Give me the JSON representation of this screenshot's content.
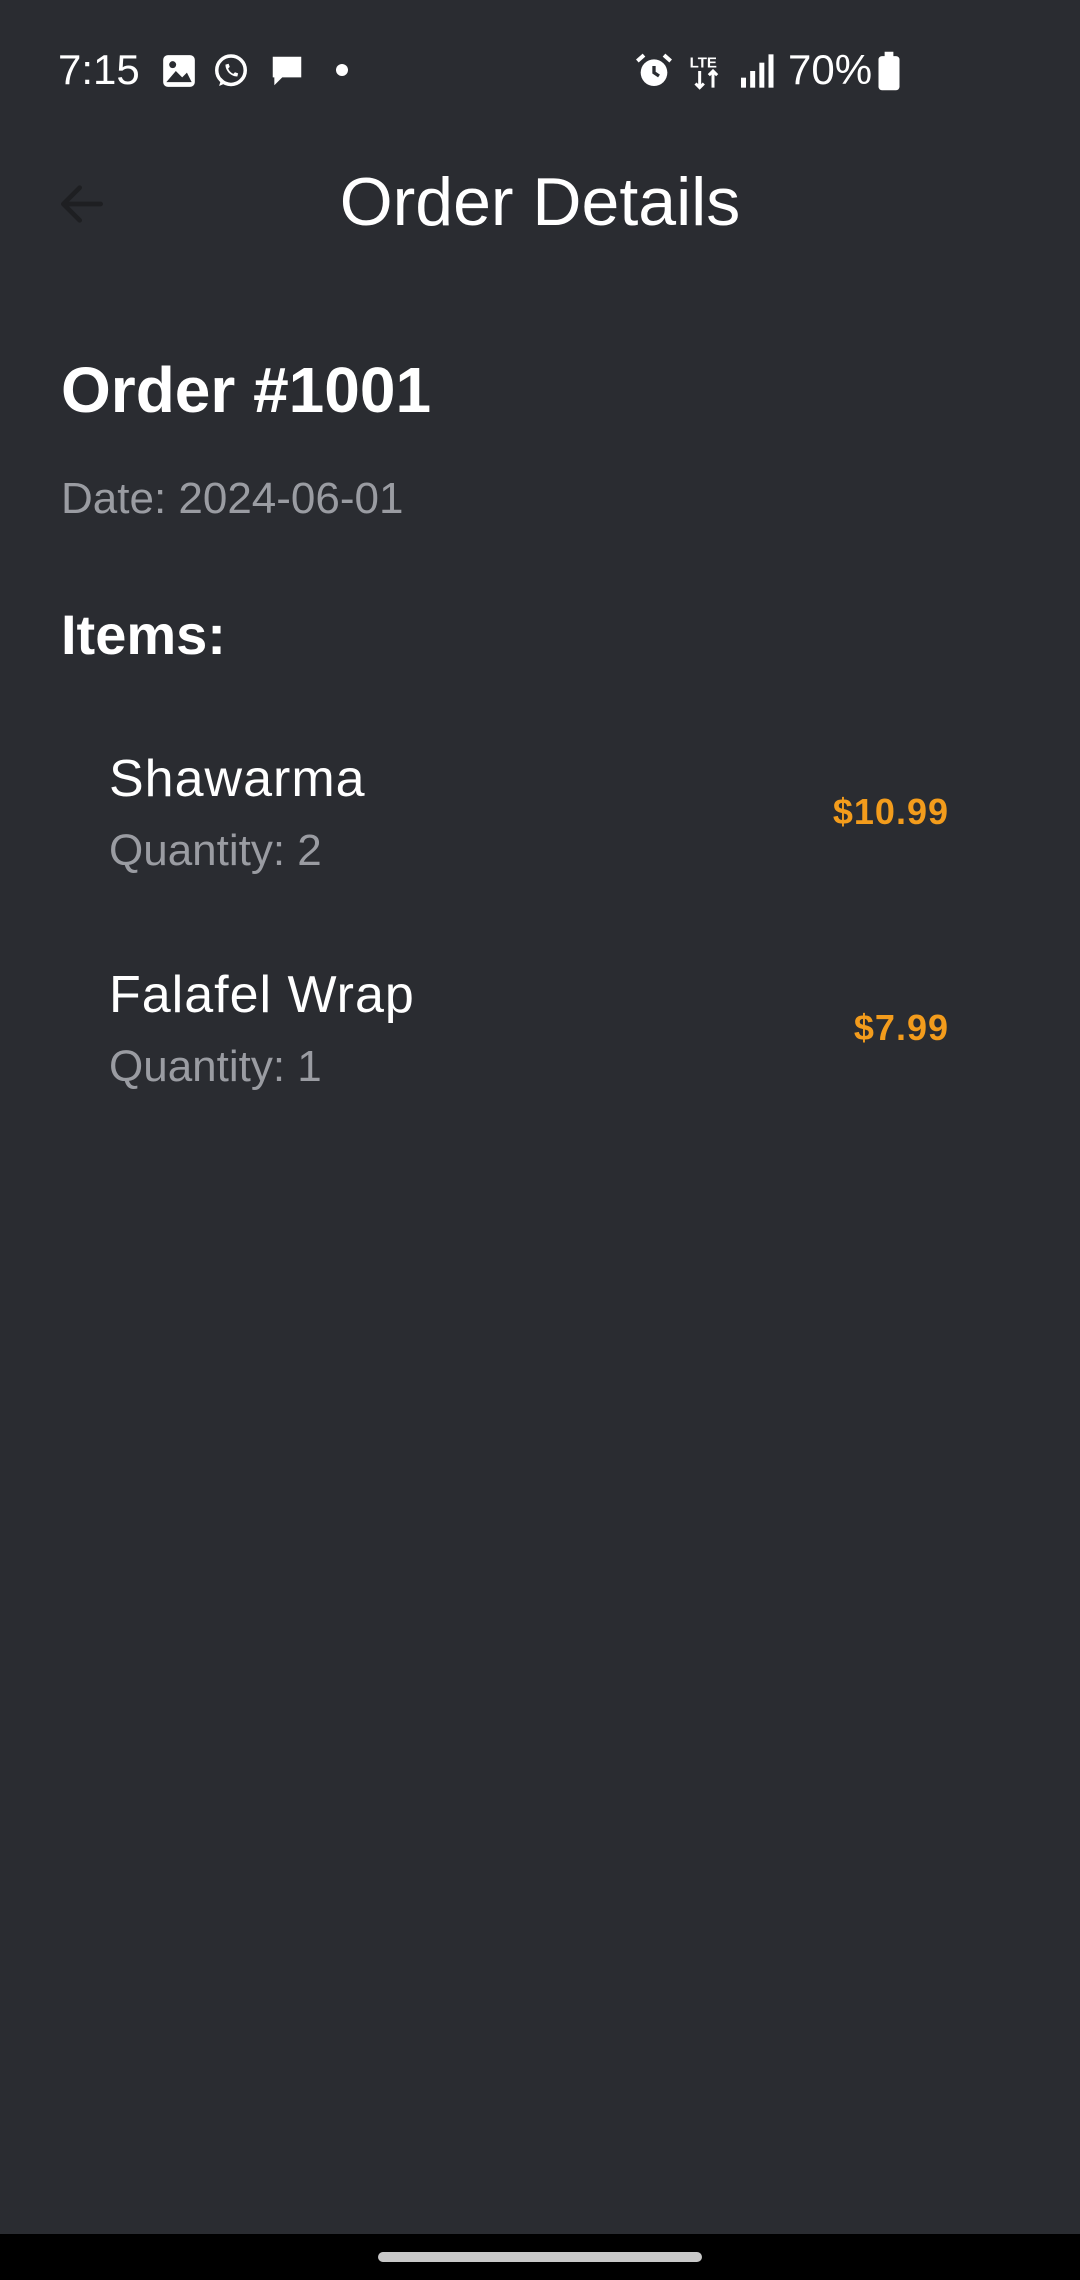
{
  "status_bar": {
    "time": "7:15",
    "battery": "70%",
    "left_icons": [
      "gallery-icon",
      "whatsapp-icon",
      "message-icon",
      "notification-dot"
    ],
    "right_icons": [
      "alarm-icon",
      "lte-icon",
      "signal-icon",
      "battery-icon"
    ]
  },
  "app_bar": {
    "title": "Order Details",
    "back_icon": "arrow-back-icon"
  },
  "order": {
    "title": "Order #1001",
    "date": "Date: 2024-06-01",
    "items_heading": "Items:",
    "items": [
      {
        "name": "Shawarma",
        "quantity": "Quantity: 2",
        "price": "$10.99"
      },
      {
        "name": "Falafel Wrap",
        "quantity": "Quantity: 1",
        "price": "$7.99"
      }
    ]
  },
  "colors": {
    "background": "#2a2c31",
    "price": "#f39c1c",
    "secondary_text": "#9a9ca2"
  }
}
